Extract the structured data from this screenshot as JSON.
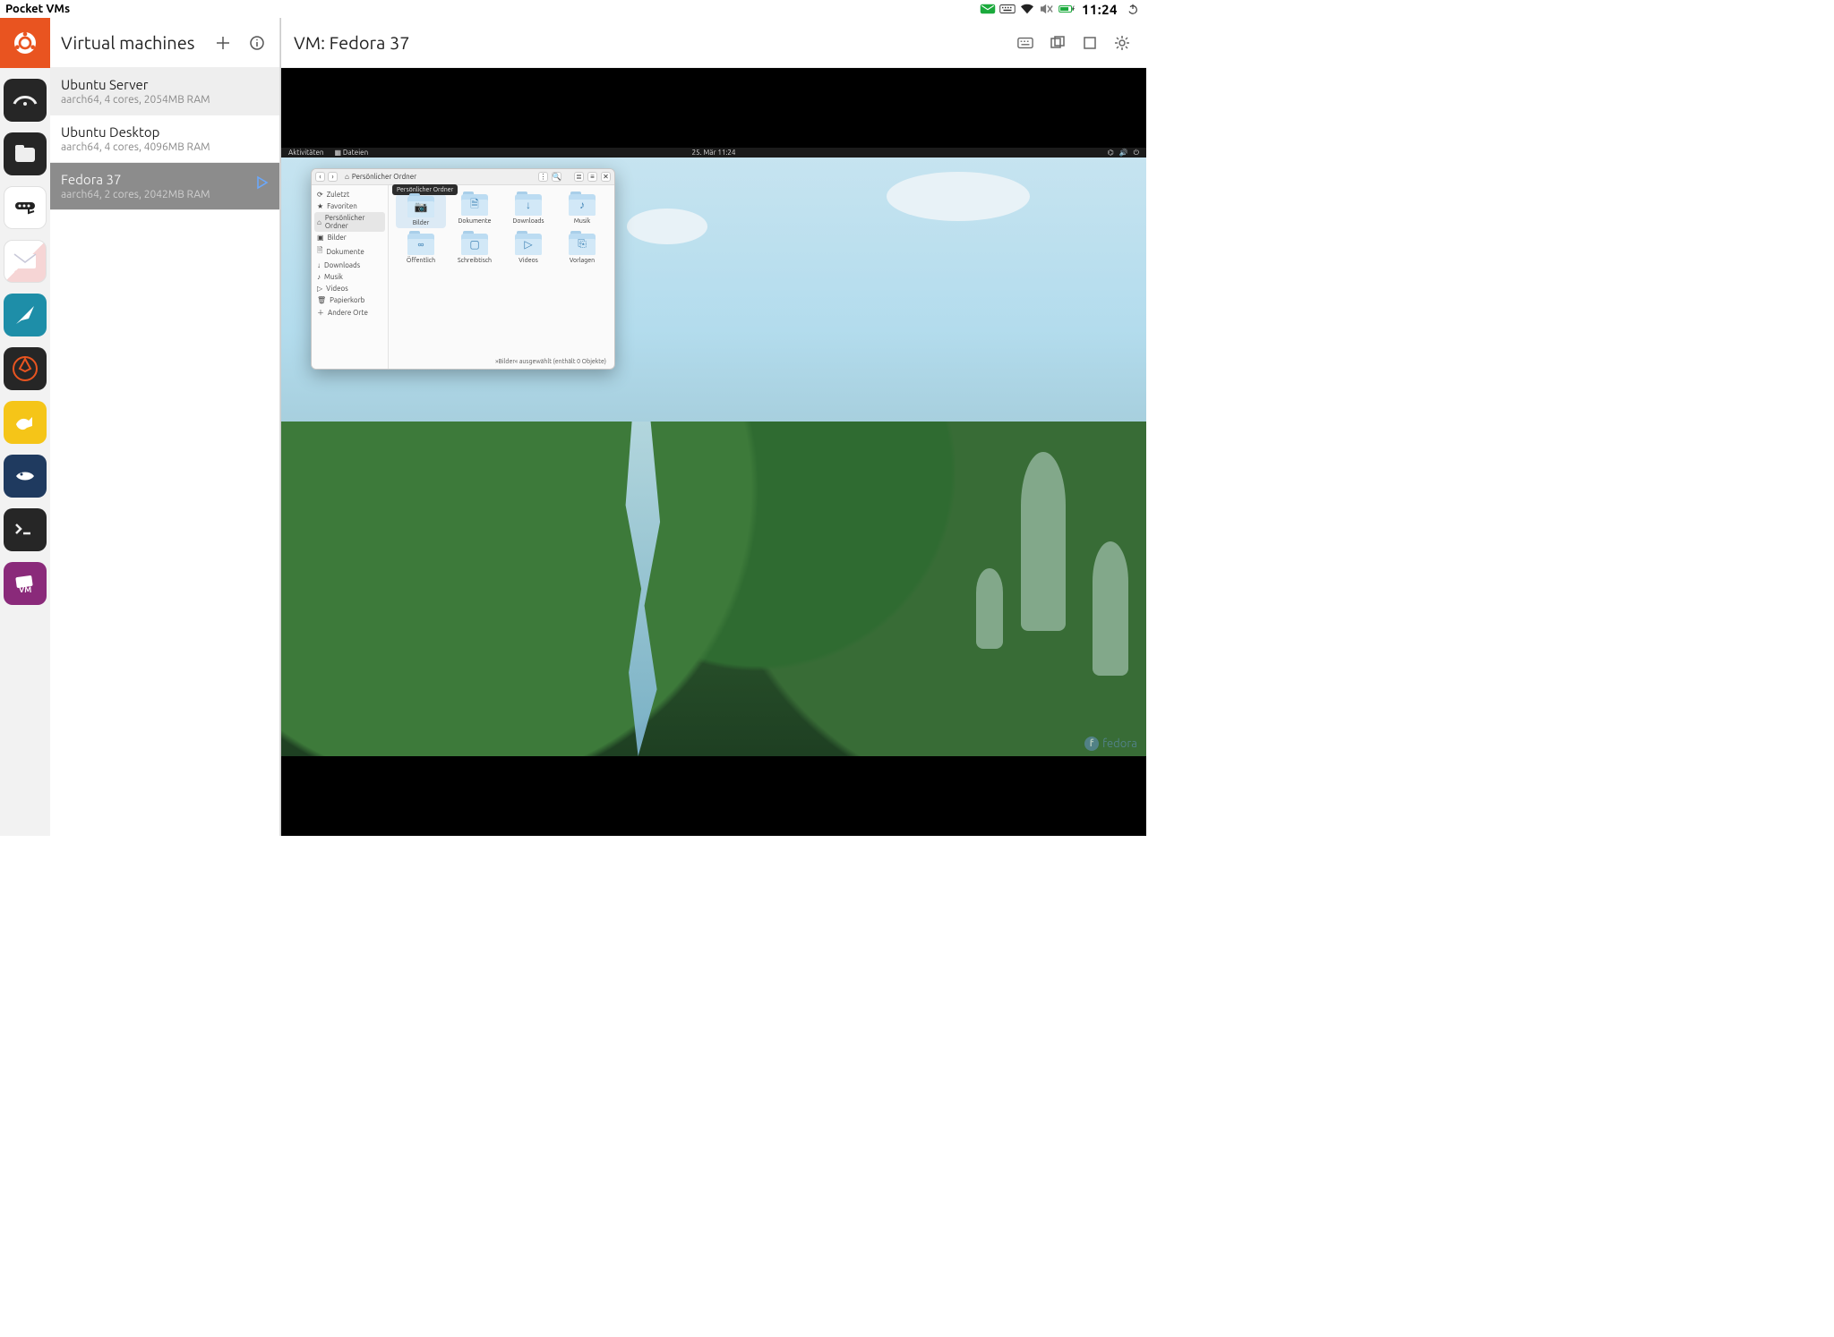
{
  "app_title": "Pocket VMs",
  "topbar": {
    "time": "11:24"
  },
  "sidebar": {
    "title": "Virtual machines",
    "vms": [
      {
        "name": "Ubuntu Server",
        "spec": "aarch64, 4 cores, 2054MB RAM"
      },
      {
        "name": "Ubuntu Desktop",
        "spec": "aarch64, 4 cores, 4096MB RAM"
      },
      {
        "name": "Fedora 37",
        "spec": "aarch64, 2 cores, 2042MB RAM"
      }
    ]
  },
  "pane": {
    "title": "VM: Fedora 37"
  },
  "guest": {
    "gnome": {
      "activities": "Aktivitäten",
      "files": "Dateien",
      "date": "25. Mär  11:24"
    },
    "nautilus": {
      "breadcrumb": "Persönlicher Ordner",
      "tooltip": "Persönlicher Ordner",
      "sidebar": {
        "recent": "Zuletzt",
        "favorites": "Favoriten",
        "home": "Persönlicher Ordner",
        "pictures": "Bilder",
        "documents": "Dokumente",
        "downloads": "Downloads",
        "music": "Musik",
        "videos": "Videos",
        "trash": "Papierkorb",
        "other": "Andere Orte"
      },
      "folders": {
        "pictures": "Bilder",
        "documents": "Dokumente",
        "downloads": "Downloads",
        "music": "Musik",
        "public": "Öffentlich",
        "desktop": "Schreibtisch",
        "videos": "Videos",
        "templates": "Vorlagen"
      },
      "status": "»Bilder« ausgewählt (enthält 0 Objekte)"
    },
    "fedora_label": "fedora"
  }
}
